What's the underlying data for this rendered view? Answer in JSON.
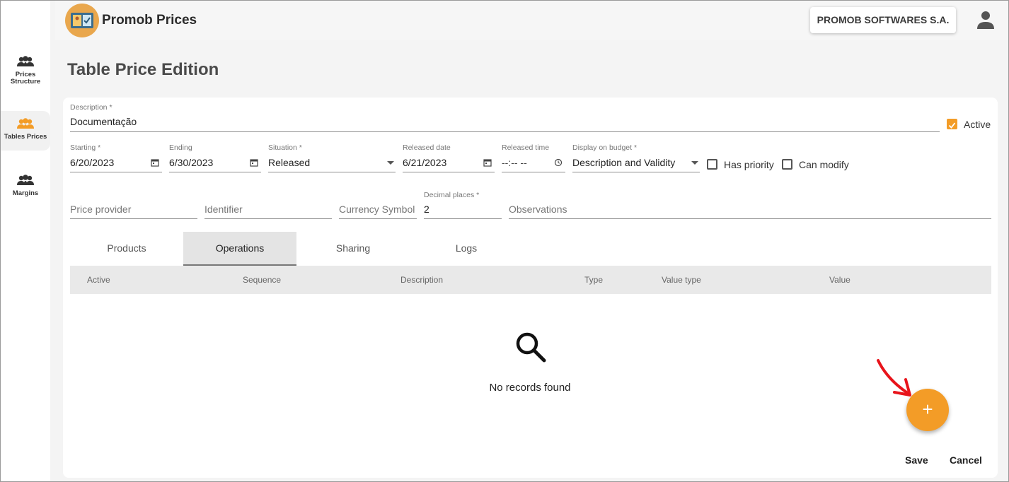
{
  "app": {
    "title": "Promob Prices",
    "company": "PROMOB SOFTWARES S.A."
  },
  "sidebar": {
    "items": [
      {
        "label_line1": "Prices",
        "label_line2": "Structure"
      },
      {
        "label_line1": "Tables Prices",
        "label_line2": ""
      },
      {
        "label_line1": "Margins",
        "label_line2": ""
      }
    ],
    "active_index": 1
  },
  "page": {
    "title": "Table Price Edition"
  },
  "form": {
    "description": {
      "label": "Description *",
      "value": "Documentação"
    },
    "active": {
      "label": "Active",
      "checked": true
    },
    "starting": {
      "label": "Starting *",
      "value": "6/20/2023"
    },
    "ending": {
      "label": "Ending",
      "value": "6/30/2023"
    },
    "situation": {
      "label": "Situation *",
      "value": "Released"
    },
    "released_date": {
      "label": "Released date",
      "value": "6/21/2023"
    },
    "released_time": {
      "label": "Released time",
      "value": "--:-- --"
    },
    "display_on_budget": {
      "label": "Display on budget *",
      "value": "Description and Validity"
    },
    "has_priority": {
      "label": "Has priority",
      "checked": false
    },
    "can_modify": {
      "label": "Can modify",
      "checked": false
    },
    "price_provider": {
      "placeholder": "Price provider"
    },
    "identifier": {
      "placeholder": "Identifier"
    },
    "currency_symbol": {
      "placeholder": "Currency Symbol"
    },
    "decimal_places": {
      "label": "Decimal places *",
      "value": "2"
    },
    "observations": {
      "placeholder": "Observations"
    }
  },
  "tabs": [
    {
      "label": "Products"
    },
    {
      "label": "Operations"
    },
    {
      "label": "Sharing"
    },
    {
      "label": "Logs"
    }
  ],
  "active_tab": 1,
  "table": {
    "columns": [
      "Active",
      "Sequence",
      "Description",
      "Type",
      "Value type",
      "Value"
    ],
    "rows": [],
    "empty_text": "No records found"
  },
  "actions": {
    "add_label": "+",
    "save": "Save",
    "cancel": "Cancel"
  },
  "colors": {
    "accent": "#f39c27",
    "annotation_arrow": "#e8141b"
  },
  "icons": {
    "sidebar": [
      "group-icon",
      "group-icon",
      "group-icon"
    ],
    "user": "account-icon",
    "calendar": "calendar-icon",
    "clock": "clock-icon",
    "empty": "search-icon"
  }
}
